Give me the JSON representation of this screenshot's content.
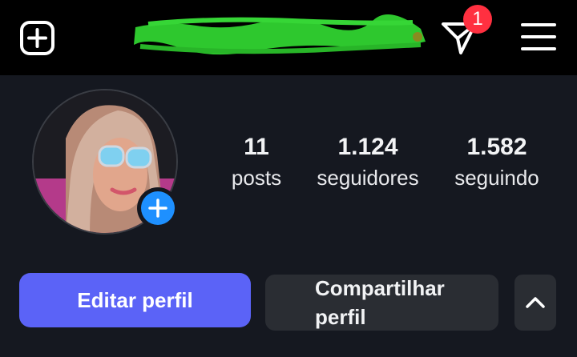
{
  "header": {
    "activity_badge_count": "1"
  },
  "icons": {
    "new_post": "plus-square-icon",
    "activity": "send-icon",
    "menu": "hamburger-menu-icon",
    "add_story": "plus-icon",
    "expand": "chevron-up-icon"
  },
  "colors": {
    "primary_button": "#5b63f7",
    "badge": "#ff3040",
    "add_story": "#1e90ff",
    "redaction": "#2ec82e"
  },
  "profile": {
    "stats": [
      {
        "value": "11",
        "label": "posts"
      },
      {
        "value": "1.124",
        "label": "seguidores"
      },
      {
        "value": "1.582",
        "label": "seguindo"
      }
    ]
  },
  "actions": {
    "edit_label": "Editar perfil",
    "share_label": "Compartilhar perfil"
  }
}
